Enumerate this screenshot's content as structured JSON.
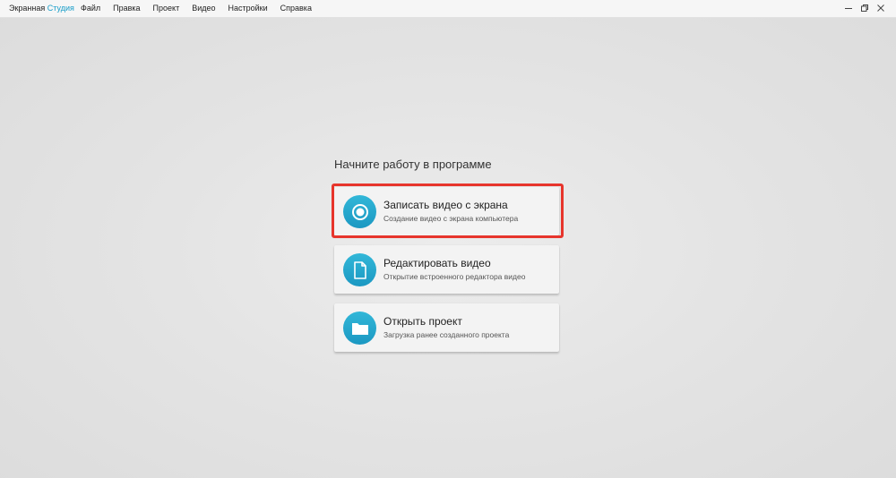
{
  "app": {
    "title_part1": "Экранная",
    "title_part2": "Студия"
  },
  "menu": {
    "items": [
      "Файл",
      "Правка",
      "Проект",
      "Видео",
      "Настройки",
      "Справка"
    ]
  },
  "window_controls": {
    "minimize": "minimize-icon",
    "restore": "restore-icon",
    "close": "close-icon"
  },
  "start": {
    "heading": "Начните работу в программе",
    "cards": [
      {
        "title": "Записать видео с экрана",
        "subtitle": "Создание видео с экрана компьютера",
        "icon": "record-icon"
      },
      {
        "title": "Редактировать видео",
        "subtitle": "Открытие встроенного редактора видео",
        "icon": "document-icon"
      },
      {
        "title": "Открыть проект",
        "subtitle": "Загрузка ранее созданного проекта",
        "icon": "folder-icon"
      }
    ]
  },
  "colors": {
    "accent": "#1a9ec9",
    "highlight": "#e7352c"
  }
}
